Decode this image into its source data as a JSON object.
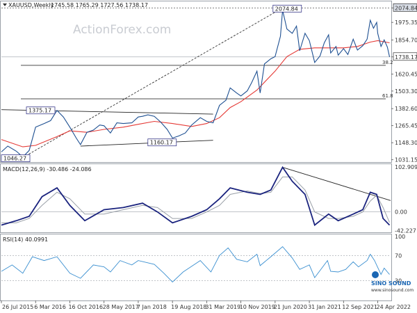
{
  "header": {
    "symbol_tf": "XAUUSD,Weekly",
    "ohlc": "1745.58 1765.29 1727.56 1738.17"
  },
  "watermark": "ActionForex.com",
  "brand": {
    "line1": "SINO SOUND",
    "line2": "www.sinosound.com"
  },
  "chart_data": [
    {
      "type": "line",
      "title": "XAUUSD,Weekly",
      "price_axis_ticks": [
        "2074.84",
        "1975.35",
        "1854.70",
        "1738.17",
        "1620.45",
        "1503.30",
        "1382.60",
        "1265.45",
        "1148.30",
        "1031.15"
      ],
      "x_tick_labels": [
        "26 Jul 2015",
        "6 Mar 2016",
        "16 Oct 2016",
        "28 May 2017",
        "7 Jan 2018",
        "19 Aug 2018",
        "31 Mar 2019",
        "10 Nov 2019",
        "21 Jun 2020",
        "31 Jan 2021",
        "12 Sep 2021",
        "24 Apr 2022"
      ],
      "ylim": [
        1020,
        2110
      ],
      "current_price": "1738.17",
      "annotations": {
        "high_label": "2074.84",
        "swing_high_label": "1375.17",
        "swing_low_label": "1160.17",
        "start_low_label": "1046.27",
        "fib_382": "38.2",
        "fib_618": "61.8"
      },
      "series": [
        {
          "name": "price",
          "points": [
            [
              "2015-07-26",
              1085
            ],
            [
              "2015-09-06",
              1125
            ],
            [
              "2015-11-01",
              1090
            ],
            [
              "2015-12-13",
              1050
            ],
            [
              "2016-01-24",
              1095
            ],
            [
              "2016-03-06",
              1255
            ],
            [
              "2016-05-01",
              1280
            ],
            [
              "2016-06-12",
              1300
            ],
            [
              "2016-07-24",
              1370
            ],
            [
              "2016-09-04",
              1325
            ],
            [
              "2016-10-16",
              1255
            ],
            [
              "2016-11-27",
              1180
            ],
            [
              "2016-12-25",
              1135
            ],
            [
              "2017-02-05",
              1220
            ],
            [
              "2017-03-19",
              1235
            ],
            [
              "2017-04-30",
              1270
            ],
            [
              "2017-05-28",
              1265
            ],
            [
              "2017-07-09",
              1215
            ],
            [
              "2017-08-20",
              1285
            ],
            [
              "2017-10-01",
              1280
            ],
            [
              "2017-11-26",
              1285
            ],
            [
              "2018-01-07",
              1325
            ],
            [
              "2018-02-04",
              1330
            ],
            [
              "2018-03-11",
              1340
            ],
            [
              "2018-04-22",
              1330
            ],
            [
              "2018-06-03",
              1290
            ],
            [
              "2018-07-15",
              1240
            ],
            [
              "2018-08-19",
              1180
            ],
            [
              "2018-09-30",
              1195
            ],
            [
              "2018-11-11",
              1215
            ],
            [
              "2018-12-23",
              1270
            ],
            [
              "2019-02-17",
              1320
            ],
            [
              "2019-03-31",
              1295
            ],
            [
              "2019-05-12",
              1285
            ],
            [
              "2019-06-23",
              1405
            ],
            [
              "2019-08-04",
              1440
            ],
            [
              "2019-09-01",
              1525
            ],
            [
              "2019-10-13",
              1490
            ],
            [
              "2019-11-10",
              1470
            ],
            [
              "2019-12-22",
              1505
            ],
            [
              "2020-01-19",
              1560
            ],
            [
              "2020-02-23",
              1640
            ],
            [
              "2020-03-15",
              1490
            ],
            [
              "2020-04-12",
              1690
            ],
            [
              "2020-05-24",
              1725
            ],
            [
              "2020-06-21",
              1740
            ],
            [
              "2020-07-26",
              1880
            ],
            [
              "2020-08-09",
              2060
            ],
            [
              "2020-09-06",
              1930
            ],
            [
              "2020-10-11",
              1900
            ],
            [
              "2020-11-08",
              1950
            ],
            [
              "2020-11-29",
              1780
            ],
            [
              "2021-01-03",
              1900
            ],
            [
              "2021-01-31",
              1850
            ],
            [
              "2021-03-07",
              1700
            ],
            [
              "2021-04-11",
              1745
            ],
            [
              "2021-05-09",
              1835
            ],
            [
              "2021-06-06",
              1890
            ],
            [
              "2021-06-20",
              1765
            ],
            [
              "2021-07-25",
              1810
            ],
            [
              "2021-08-08",
              1750
            ],
            [
              "2021-09-12",
              1795
            ],
            [
              "2021-10-10",
              1755
            ],
            [
              "2021-11-14",
              1860
            ],
            [
              "2021-12-12",
              1785
            ],
            [
              "2022-01-16",
              1815
            ],
            [
              "2022-02-13",
              1860
            ],
            [
              "2022-03-06",
              1990
            ],
            [
              "2022-03-27",
              1935
            ],
            [
              "2022-04-17",
              1975
            ],
            [
              "2022-04-24",
              1900
            ],
            [
              "2022-05-15",
              1810
            ],
            [
              "2022-06-05",
              1855
            ],
            [
              "2022-06-26",
              1805
            ],
            [
              "2022-07-10",
              1738
            ]
          ]
        },
        {
          "name": "moving_average",
          "points": [
            [
              "2015-07-26",
              1170
            ],
            [
              "2015-12-13",
              1120
            ],
            [
              "2016-03-06",
              1130
            ],
            [
              "2016-07-24",
              1190
            ],
            [
              "2016-10-16",
              1230
            ],
            [
              "2017-02-05",
              1220
            ],
            [
              "2017-05-28",
              1240
            ],
            [
              "2017-10-01",
              1255
            ],
            [
              "2018-01-07",
              1275
            ],
            [
              "2018-04-22",
              1295
            ],
            [
              "2018-08-19",
              1280
            ],
            [
              "2018-12-23",
              1260
            ],
            [
              "2019-03-31",
              1280
            ],
            [
              "2019-06-23",
              1320
            ],
            [
              "2019-09-01",
              1390
            ],
            [
              "2019-11-10",
              1430
            ],
            [
              "2020-02-23",
              1510
            ],
            [
              "2020-06-21",
              1640
            ],
            [
              "2020-09-06",
              1740
            ],
            [
              "2020-11-29",
              1790
            ],
            [
              "2021-03-07",
              1800
            ],
            [
              "2021-06-20",
              1800
            ],
            [
              "2021-09-12",
              1800
            ],
            [
              "2021-12-12",
              1810
            ],
            [
              "2022-03-06",
              1840
            ],
            [
              "2022-04-24",
              1850
            ],
            [
              "2022-07-10",
              1835
            ]
          ]
        }
      ]
    },
    {
      "type": "line",
      "title": "MACD(12,26,9) -30.486 -24.086",
      "ylabels": [
        "102.909",
        "0.00",
        "-42.227"
      ],
      "ylim": [
        -45,
        106
      ],
      "series": [
        {
          "name": "MACD",
          "points": [
            [
              "2015-07-26",
              -30
            ],
            [
              "2015-11-01",
              -20
            ],
            [
              "2016-01-24",
              -10
            ],
            [
              "2016-04-17",
              35
            ],
            [
              "2016-07-24",
              55
            ],
            [
              "2016-10-16",
              15
            ],
            [
              "2017-01-22",
              -20
            ],
            [
              "2017-05-28",
              5
            ],
            [
              "2017-10-01",
              10
            ],
            [
              "2018-02-04",
              20
            ],
            [
              "2018-05-13",
              0
            ],
            [
              "2018-08-19",
              -25
            ],
            [
              "2018-12-23",
              -10
            ],
            [
              "2019-03-31",
              5
            ],
            [
              "2019-06-23",
              30
            ],
            [
              "2019-09-01",
              55
            ],
            [
              "2019-12-22",
              45
            ],
            [
              "2020-03-15",
              40
            ],
            [
              "2020-05-24",
              50
            ],
            [
              "2020-08-09",
              102
            ],
            [
              "2020-10-11",
              70
            ],
            [
              "2021-01-03",
              40
            ],
            [
              "2021-03-07",
              -30
            ],
            [
              "2021-06-06",
              -5
            ],
            [
              "2021-08-08",
              -20
            ],
            [
              "2021-11-14",
              -5
            ],
            [
              "2022-01-16",
              5
            ],
            [
              "2022-03-06",
              45
            ],
            [
              "2022-04-17",
              40
            ],
            [
              "2022-05-29",
              -15
            ],
            [
              "2022-07-10",
              -30
            ]
          ]
        },
        {
          "name": "Signal",
          "points": [
            [
              "2015-07-26",
              -25
            ],
            [
              "2015-11-01",
              -25
            ],
            [
              "2016-01-24",
              -15
            ],
            [
              "2016-04-17",
              15
            ],
            [
              "2016-07-24",
              45
            ],
            [
              "2016-10-16",
              30
            ],
            [
              "2017-01-22",
              -5
            ],
            [
              "2017-05-28",
              -5
            ],
            [
              "2017-10-01",
              5
            ],
            [
              "2018-02-04",
              15
            ],
            [
              "2018-05-13",
              10
            ],
            [
              "2018-08-19",
              -15
            ],
            [
              "2018-12-23",
              -15
            ],
            [
              "2019-03-31",
              0
            ],
            [
              "2019-06-23",
              15
            ],
            [
              "2019-09-01",
              40
            ],
            [
              "2019-12-22",
              48
            ],
            [
              "2020-03-15",
              42
            ],
            [
              "2020-05-24",
              45
            ],
            [
              "2020-08-09",
              80
            ],
            [
              "2020-10-11",
              80
            ],
            [
              "2021-01-03",
              50
            ],
            [
              "2021-03-07",
              0
            ],
            [
              "2021-06-06",
              -15
            ],
            [
              "2021-08-08",
              -15
            ],
            [
              "2021-11-14",
              -10
            ],
            [
              "2022-01-16",
              0
            ],
            [
              "2022-03-06",
              25
            ],
            [
              "2022-04-17",
              38
            ],
            [
              "2022-05-29",
              10
            ],
            [
              "2022-07-10",
              -24
            ]
          ]
        }
      ]
    },
    {
      "type": "line",
      "title": "RSI(14) 40.0991",
      "ylabels": [
        "100",
        "70",
        "30"
      ],
      "ylim": [
        0,
        100
      ],
      "series": [
        {
          "name": "RSI",
          "points": [
            [
              "2015-07-26",
              45
            ],
            [
              "2015-10-04",
              55
            ],
            [
              "2015-12-13",
              42
            ],
            [
              "2016-02-14",
              68
            ],
            [
              "2016-05-01",
              62
            ],
            [
              "2016-07-24",
              68
            ],
            [
              "2016-10-16",
              42
            ],
            [
              "2016-12-25",
              34
            ],
            [
              "2017-03-19",
              55
            ],
            [
              "2017-05-28",
              52
            ],
            [
              "2017-07-09",
              44
            ],
            [
              "2017-09-10",
              62
            ],
            [
              "2017-11-26",
              55
            ],
            [
              "2018-01-07",
              62
            ],
            [
              "2018-04-22",
              56
            ],
            [
              "2018-06-24",
              42
            ],
            [
              "2018-08-19",
              28
            ],
            [
              "2018-10-28",
              44
            ],
            [
              "2019-02-17",
              62
            ],
            [
              "2019-04-28",
              44
            ],
            [
              "2019-06-23",
              70
            ],
            [
              "2019-08-18",
              82
            ],
            [
              "2019-10-13",
              64
            ],
            [
              "2019-12-22",
              60
            ],
            [
              "2020-02-23",
              72
            ],
            [
              "2020-03-15",
              54
            ],
            [
              "2020-05-24",
              68
            ],
            [
              "2020-08-09",
              84
            ],
            [
              "2020-10-11",
              66
            ],
            [
              "2020-11-29",
              48
            ],
            [
              "2021-01-31",
              55
            ],
            [
              "2021-03-07",
              35
            ],
            [
              "2021-05-30",
              62
            ],
            [
              "2021-06-20",
              45
            ],
            [
              "2021-08-08",
              44
            ],
            [
              "2021-09-26",
              48
            ],
            [
              "2021-11-14",
              60
            ],
            [
              "2021-12-19",
              52
            ],
            [
              "2022-02-13",
              62
            ],
            [
              "2022-03-06",
              72
            ],
            [
              "2022-04-03",
              62
            ],
            [
              "2022-05-15",
              40
            ],
            [
              "2022-06-05",
              50
            ],
            [
              "2022-06-26",
              44
            ],
            [
              "2022-07-10",
              40
            ]
          ]
        }
      ]
    }
  ]
}
